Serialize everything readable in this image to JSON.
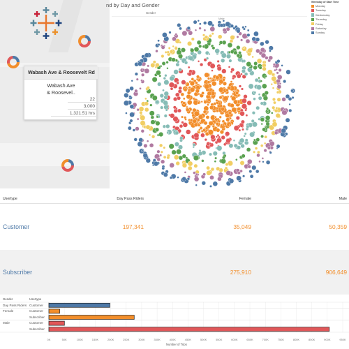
{
  "map": {
    "tooltip": {
      "header": "Wabash Ave & Roosevelt Rd",
      "title_line1": "Wabash Ave",
      "title_line2": "& Roosevel..",
      "values": [
        "22",
        "3,000",
        "1,321.51 hrs"
      ]
    }
  },
  "chart": {
    "title": "nd by Day and Gender",
    "header_gender": "Gender",
    "header_male": "Male"
  },
  "legend": {
    "title": "Weekday of Start Time",
    "items": [
      {
        "label": "Monday",
        "color": "#f28e2b"
      },
      {
        "label": "Tuesday",
        "color": "#e15759"
      },
      {
        "label": "Wednesday",
        "color": "#86bcb6"
      },
      {
        "label": "Thursday",
        "color": "#59a14f"
      },
      {
        "label": "Friday",
        "color": "#f1ce63"
      },
      {
        "label": "Saturday",
        "color": "#b07aa1"
      },
      {
        "label": "Sunday",
        "color": "#4e79a7"
      }
    ]
  },
  "crosstab": {
    "headers": {
      "usertype": "Usertype",
      "day_pass": "Day Pass Riders",
      "female": "Female",
      "male": "Male"
    },
    "rows": [
      {
        "label": "Customer",
        "day_pass": "197,341",
        "female": "35,049",
        "male": "50,359"
      },
      {
        "label": "Subscriber",
        "day_pass": "",
        "female": "275,910",
        "male": "906,649"
      }
    ]
  },
  "chart_data": {
    "type": "bar",
    "orientation": "horizontal",
    "row_headers": {
      "gender": "Gender",
      "usertype": "Usertype"
    },
    "rows": [
      {
        "gender": "Day Pass Riders",
        "usertype": "Customer",
        "value": 197341,
        "color": "#4e79a7"
      },
      {
        "gender": "Female",
        "usertype": "Customer",
        "value": 35049,
        "color": "#f28e2b"
      },
      {
        "gender": "",
        "usertype": "Subscriber",
        "value": 275910,
        "color": "#f28e2b"
      },
      {
        "gender": "Male",
        "usertype": "Customer",
        "value": 50359,
        "color": "#e15759"
      },
      {
        "gender": "",
        "usertype": "Subscriber",
        "value": 906649,
        "color": "#e15759"
      }
    ],
    "xlabel": "Number of Trips",
    "xlim": [
      0,
      950000
    ],
    "ticks": [
      0,
      50000,
      100000,
      150000,
      200000,
      250000,
      300000,
      350000,
      400000,
      450000,
      500000,
      550000,
      600000,
      650000,
      700000,
      750000,
      800000,
      850000,
      900000,
      950000
    ],
    "tick_labels": [
      "0K",
      "50K",
      "100K",
      "150K",
      "200K",
      "250K",
      "300K",
      "350K",
      "400K",
      "450K",
      "500K",
      "550K",
      "600K",
      "650K",
      "700K",
      "750K",
      "800K",
      "850K",
      "900K",
      "950K"
    ]
  }
}
